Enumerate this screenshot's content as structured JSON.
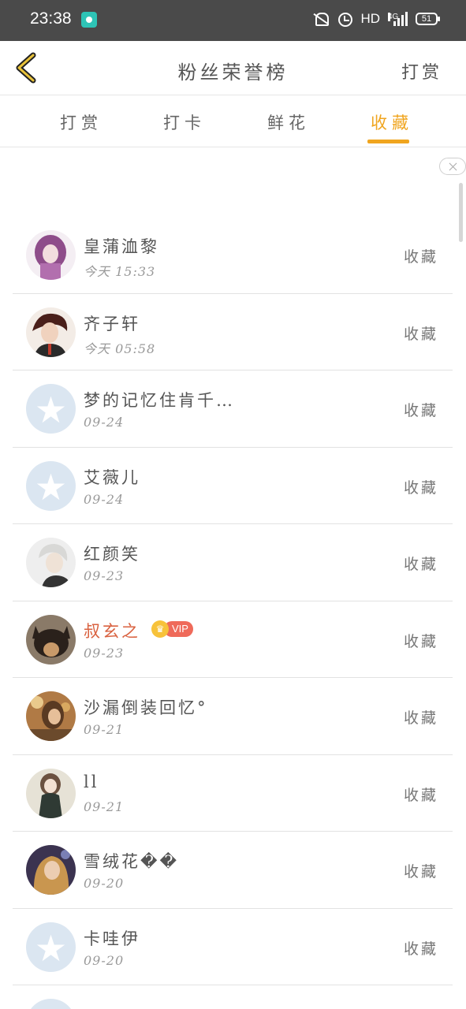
{
  "status_bar": {
    "time": "23:38",
    "hd": "HD",
    "network": "4G",
    "battery": "51"
  },
  "header": {
    "title": "粉丝荣誉榜",
    "action": "打赏"
  },
  "tabs": [
    {
      "label": "打赏",
      "active": false
    },
    {
      "label": "打卡",
      "active": false
    },
    {
      "label": "鲜花",
      "active": false
    },
    {
      "label": "收藏",
      "active": true
    }
  ],
  "rows": [
    {
      "name": "皇蒲洫黎",
      "time": "今天 15:33",
      "action": "收藏",
      "avatar": "purple-hair",
      "vip": false
    },
    {
      "name": "齐子轩",
      "time": "今天 05:58",
      "action": "收藏",
      "avatar": "red-hair",
      "vip": false
    },
    {
      "name": "梦的记忆住肯千…",
      "time": "09-24",
      "action": "收藏",
      "avatar": "default",
      "vip": false
    },
    {
      "name": "艾薇儿",
      "time": "09-24",
      "action": "收藏",
      "avatar": "default",
      "vip": false
    },
    {
      "name": "红颜笑",
      "time": "09-23",
      "action": "收藏",
      "avatar": "white-hair",
      "vip": false
    },
    {
      "name": "叔玄之",
      "time": "09-23",
      "action": "收藏",
      "avatar": "dog",
      "vip": true,
      "vip_label": "VIP"
    },
    {
      "name": "沙漏倒装回忆°",
      "time": "09-21",
      "action": "收藏",
      "avatar": "golden",
      "vip": false
    },
    {
      "name": "ll",
      "time": "09-21",
      "action": "收藏",
      "avatar": "girl-dark",
      "vip": false
    },
    {
      "name": "雪绒花��",
      "time": "09-20",
      "action": "收藏",
      "avatar": "blonde",
      "vip": false
    },
    {
      "name": "卡哇伊",
      "time": "09-20",
      "action": "收藏",
      "avatar": "default",
      "vip": false
    }
  ],
  "colors": {
    "accent": "#f0a51f",
    "vip_name": "#d9613f",
    "vip_badge": "#ef6a5a",
    "status_bar": "#4a4a4a"
  }
}
